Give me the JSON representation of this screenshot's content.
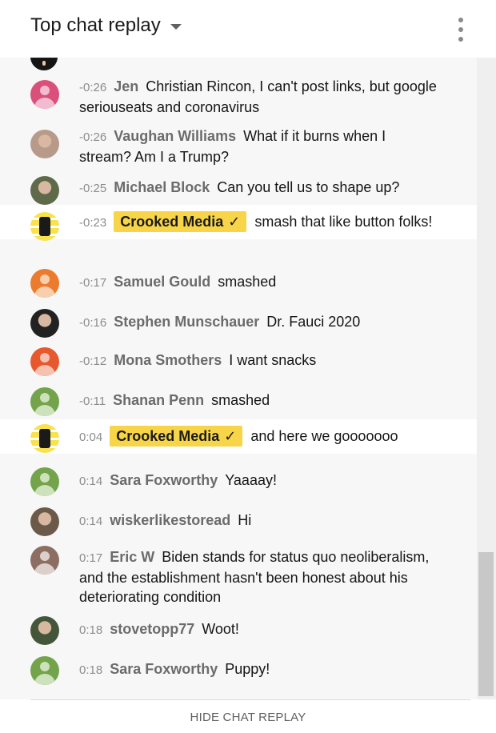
{
  "header": {
    "title": "Top chat replay",
    "menu_icon": "kebab-menu-icon",
    "dropdown_icon": "caret-down-icon"
  },
  "messages": [
    {
      "time": "-0:26",
      "author": "Jen",
      "text": "Christian Rincon, I can't post links, but google seriouseats and coronavirus",
      "avatar": "default",
      "avatar_color": "#d9507a",
      "avatar_light": "#f2bcd0"
    },
    {
      "time": "-0:26",
      "author": "Vaughan Williams",
      "text": "What if it burns when I stream? Am I a Trump?",
      "avatar": "photo"
    },
    {
      "time": "-0:25",
      "author": "Michael Block",
      "text": "Can you tell us to shape up?",
      "avatar": "photo"
    },
    {
      "time": "-0:23",
      "author": "Crooked Media",
      "verified": true,
      "text": "smash that like button folks!",
      "avatar": "crooked",
      "highlighted": true
    },
    {
      "time": "-0:17",
      "author": "Samuel Gould",
      "text": "smashed",
      "avatar": "default",
      "avatar_color": "#ec7b2e",
      "avatar_light": "#f8cfae"
    },
    {
      "time": "-0:16",
      "author": "Stephen Munschauer",
      "text": "Dr. Fauci 2020",
      "avatar": "photo"
    },
    {
      "time": "-0:12",
      "author": "Mona Smothers",
      "text": "I want snacks",
      "avatar": "default",
      "avatar_color": "#e8582e",
      "avatar_light": "#f6c2b0"
    },
    {
      "time": "-0:11",
      "author": "Shanan Penn",
      "text": "smashed",
      "avatar": "default",
      "avatar_color": "#73a34a",
      "avatar_light": "#cde1bb"
    },
    {
      "time": "0:04",
      "author": "Crooked Media",
      "verified": true,
      "text": "and here we gooooooo",
      "avatar": "crooked",
      "highlighted": true
    },
    {
      "time": "0:14",
      "author": "Sara Foxworthy",
      "text": "Yaaaay!",
      "avatar": "default",
      "avatar_color": "#73a34a",
      "avatar_light": "#cde1bb"
    },
    {
      "time": "0:14",
      "author": "wiskerlikestoread",
      "text": "Hi",
      "avatar": "photo"
    },
    {
      "time": "0:17",
      "author": "Eric W",
      "text": "Biden stands for status quo neoliberalism, and the establishment hasn't been honest about his deteriorating condition",
      "avatar": "default",
      "avatar_color": "#8d6e63",
      "avatar_light": "#ddd0cb"
    },
    {
      "time": "0:18",
      "author": "stovetopp77",
      "text": "Woot!",
      "avatar": "photo"
    },
    {
      "time": "0:18",
      "author": "Sara Foxworthy",
      "text": "Puppy!",
      "avatar": "default",
      "avatar_color": "#73a34a",
      "avatar_light": "#cde1bb"
    }
  ],
  "badge": {
    "verified_mark": "✓",
    "color": "#f8d548"
  },
  "footer": {
    "hide_label": "HIDE CHAT REPLAY"
  }
}
